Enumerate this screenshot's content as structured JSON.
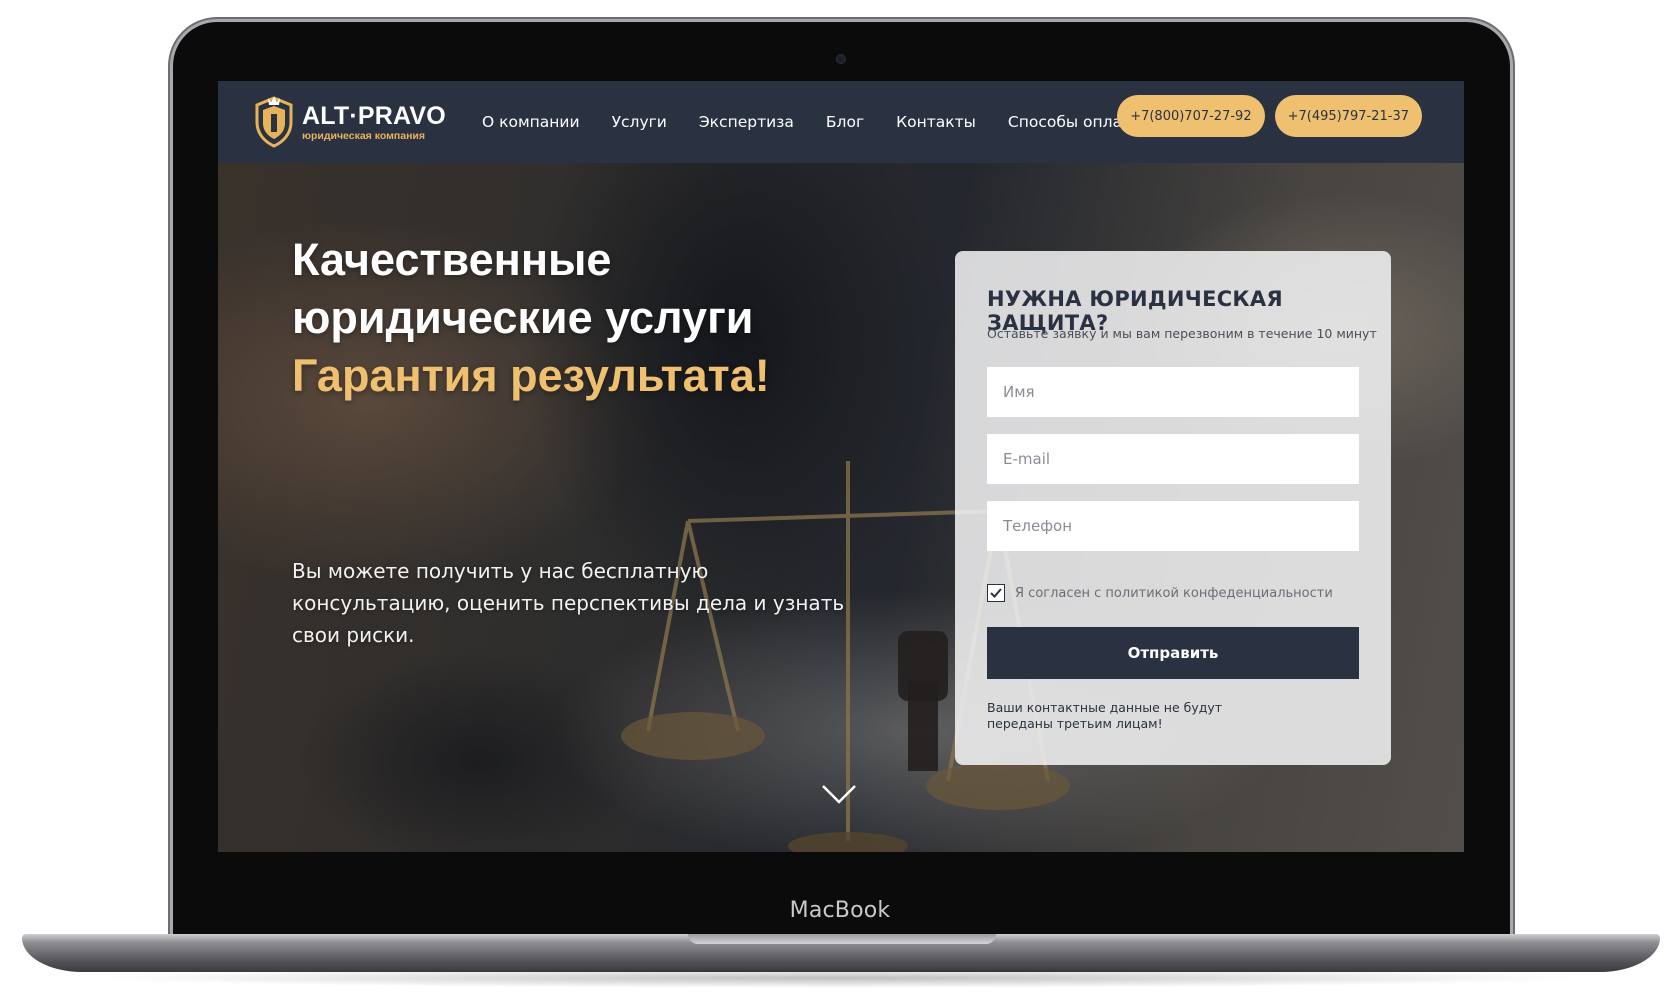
{
  "device": {
    "label": "MacBook"
  },
  "header": {
    "logo": {
      "name": "ALT·PRAVO",
      "subtitle": "юридическая компания"
    },
    "nav": [
      "О компании",
      "Услуги",
      "Экспертиза",
      "Блог",
      "Контакты",
      "Способы оплаты"
    ],
    "phones": [
      "+7(800)707-27-92",
      "+7(495)797-21-37"
    ]
  },
  "hero": {
    "title_line1": "Качественные",
    "title_line2": "юридические услуги",
    "title_accent": "Гарантия результата!",
    "description": "Вы можете получить у нас бесплатную консультацию, оценить перспективы дела и узнать свои риски."
  },
  "form": {
    "title": "НУЖНА ЮРИДИЧЕСКАЯ ЗАЩИТА?",
    "subtitle": "Оставьте заявку и мы вам перезвоним в течение 10 минут",
    "name_placeholder": "Имя",
    "email_placeholder": "E-mail",
    "phone_placeholder": "Телефон",
    "consent": "Я согласен с политикой конфеденциальности",
    "submit": "Отправить",
    "privacy_note": "Ваши контактные данные не будут переданы третьим лицам!"
  },
  "colors": {
    "header_bg": "#2a3242",
    "accent_gold": "#f0c071",
    "button_dark": "#2a3242"
  },
  "icons": [
    "shield-logo-icon",
    "check-icon",
    "chevron-down-icon"
  ]
}
